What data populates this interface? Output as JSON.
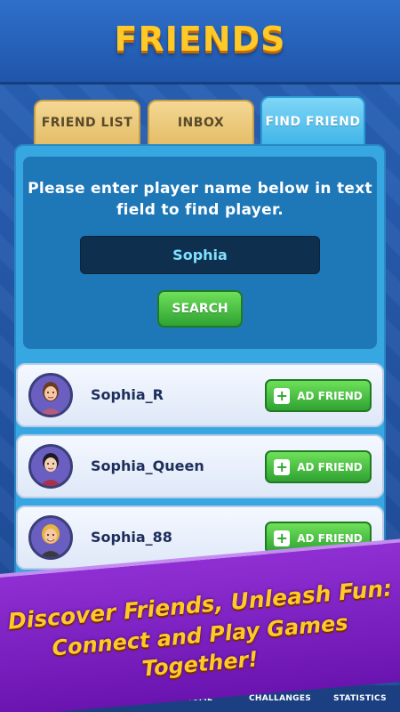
{
  "header": {
    "title": "FRIENDS"
  },
  "tabs": [
    {
      "label": "FRIEND LIST",
      "active": false
    },
    {
      "label": "INBOX",
      "active": false
    },
    {
      "label": "FIND FRIEND",
      "active": true
    }
  ],
  "search": {
    "prompt": "Please enter player name below in text field to find player.",
    "value": "Sophia",
    "button_label": "SEARCH"
  },
  "results": [
    {
      "name": "Sophia_R",
      "button_label": "AD FRIEND"
    },
    {
      "name": "Sophia_Queen",
      "button_label": "AD FRIEND"
    },
    {
      "name": "Sophia_88",
      "button_label": "AD FRIEND"
    }
  ],
  "banner": {
    "line1": "Discover Friends, Unleash Fun:",
    "line2": "Connect and Play Games",
    "line3": "Together!"
  },
  "bottom_nav": {
    "home": "HOME",
    "challenges": "CHALLANGES",
    "statistics": "STATISTICS"
  },
  "colors": {
    "accent_gold": "#ffc927",
    "active_tab": "#3fb4e8",
    "button_green": "#2fa232",
    "banner_purple": "#8f2fd3"
  }
}
